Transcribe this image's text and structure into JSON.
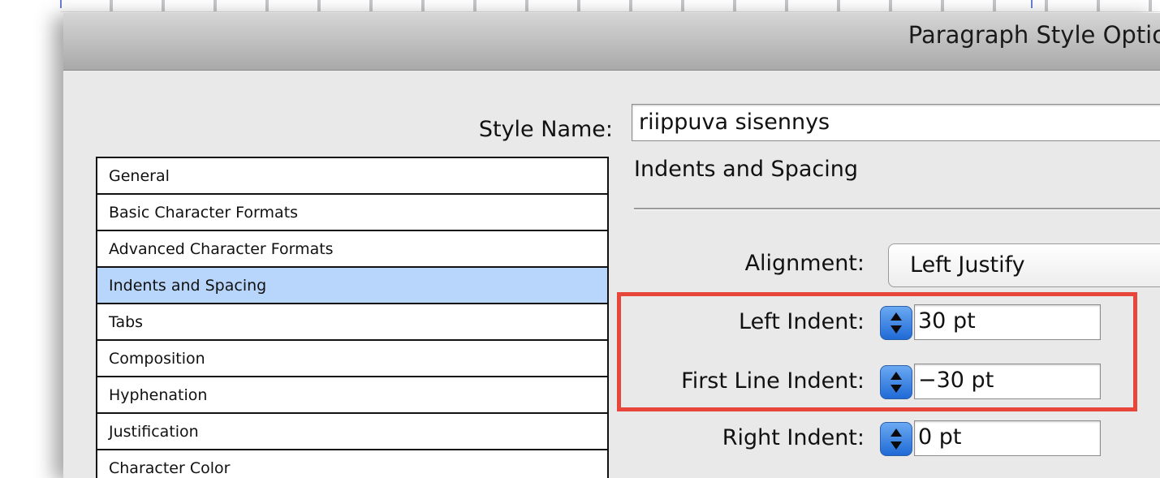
{
  "dialog": {
    "title": "Paragraph Style Optio",
    "style_name_label": "Style Name:",
    "style_name_value": "riippuva sisennys"
  },
  "categories": [
    {
      "label": "General",
      "selected": false
    },
    {
      "label": "Basic Character Formats",
      "selected": false
    },
    {
      "label": "Advanced Character Formats",
      "selected": false
    },
    {
      "label": "Indents and Spacing",
      "selected": true
    },
    {
      "label": "Tabs",
      "selected": false
    },
    {
      "label": "Composition",
      "selected": false
    },
    {
      "label": "Hyphenation",
      "selected": false
    },
    {
      "label": "Justification",
      "selected": false
    },
    {
      "label": "Character Color",
      "selected": false
    }
  ],
  "panel": {
    "heading": "Indents and Spacing",
    "alignment": {
      "label": "Alignment:",
      "value": "Left Justify"
    },
    "left_indent": {
      "label": "Left Indent:",
      "value": "30 pt"
    },
    "first_line_indent": {
      "label": "First Line Indent:",
      "value": "−30 pt"
    },
    "right_indent": {
      "label": "Right Indent:",
      "value": "0 pt"
    }
  },
  "colors": {
    "selection": "#b8d6fb",
    "highlight_box": "#e8463a",
    "spinner": "#1f6ad6"
  }
}
